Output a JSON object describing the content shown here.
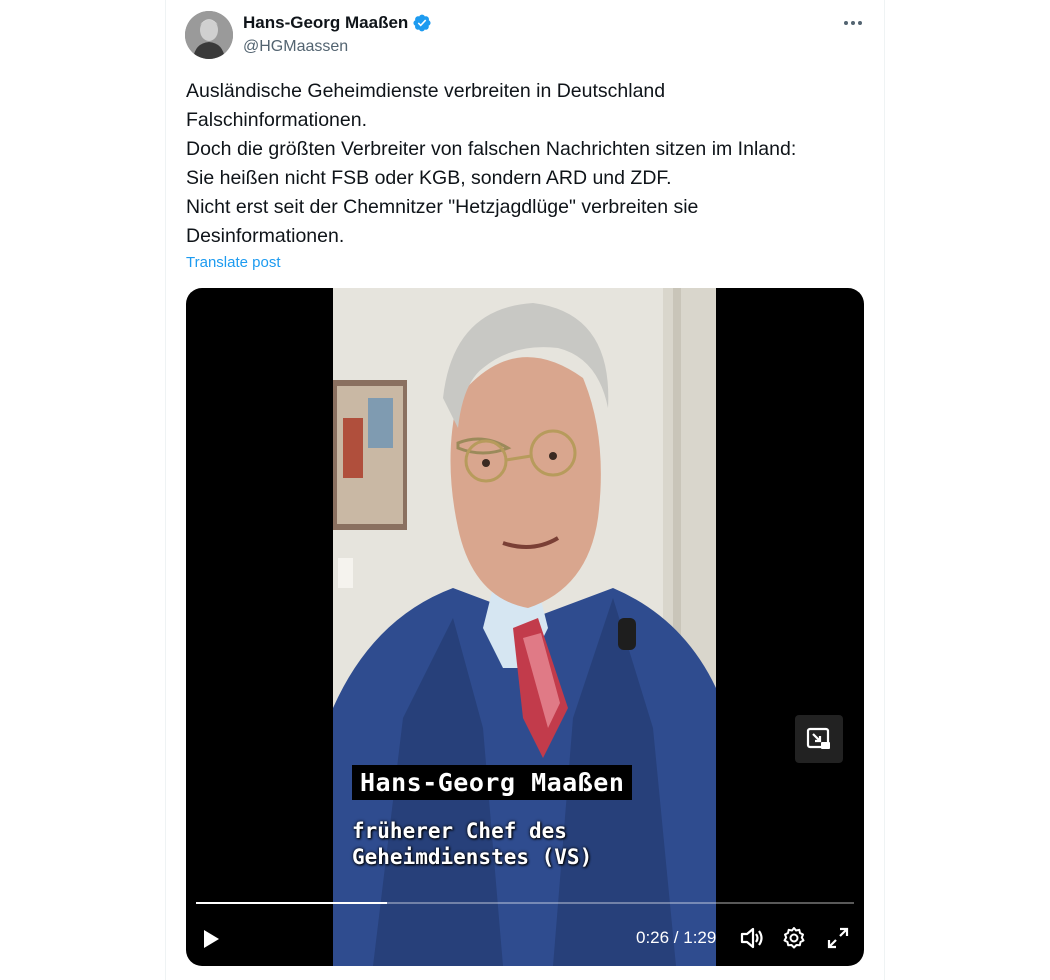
{
  "post": {
    "author": {
      "display_name": "Hans-Georg Maaßen",
      "handle": "@HGMaassen",
      "verified": true,
      "verified_color": "#1d9bf0"
    },
    "lines": [
      "Ausländische Geheimdienste verbreiten in Deutschland",
      "Falschinformationen.",
      "Doch die größten Verbreiter von falschen Nachrichten sitzen im Inland:",
      "Sie heißen nicht FSB oder KGB, sondern ARD und ZDF.",
      "Nicht erst seit der Chemnitzer \"Hetzjagdlüge\" verbreiten sie",
      "Desinformationen."
    ],
    "translate_label": "Translate post",
    "more_icon": "more-horizontal-icon"
  },
  "video": {
    "caption_name": "Hans-Georg Maaßen",
    "caption_line1": "früherer Chef des",
    "caption_line2": "Geheimdienstes (VS)",
    "time_display": "0:26 / 1:29",
    "progress": 0.29,
    "icons": {
      "play": "play-icon",
      "volume": "volume-icon",
      "settings": "settings-icon",
      "fullscreen": "fullscreen-icon",
      "pip": "picture-in-picture-icon"
    }
  }
}
